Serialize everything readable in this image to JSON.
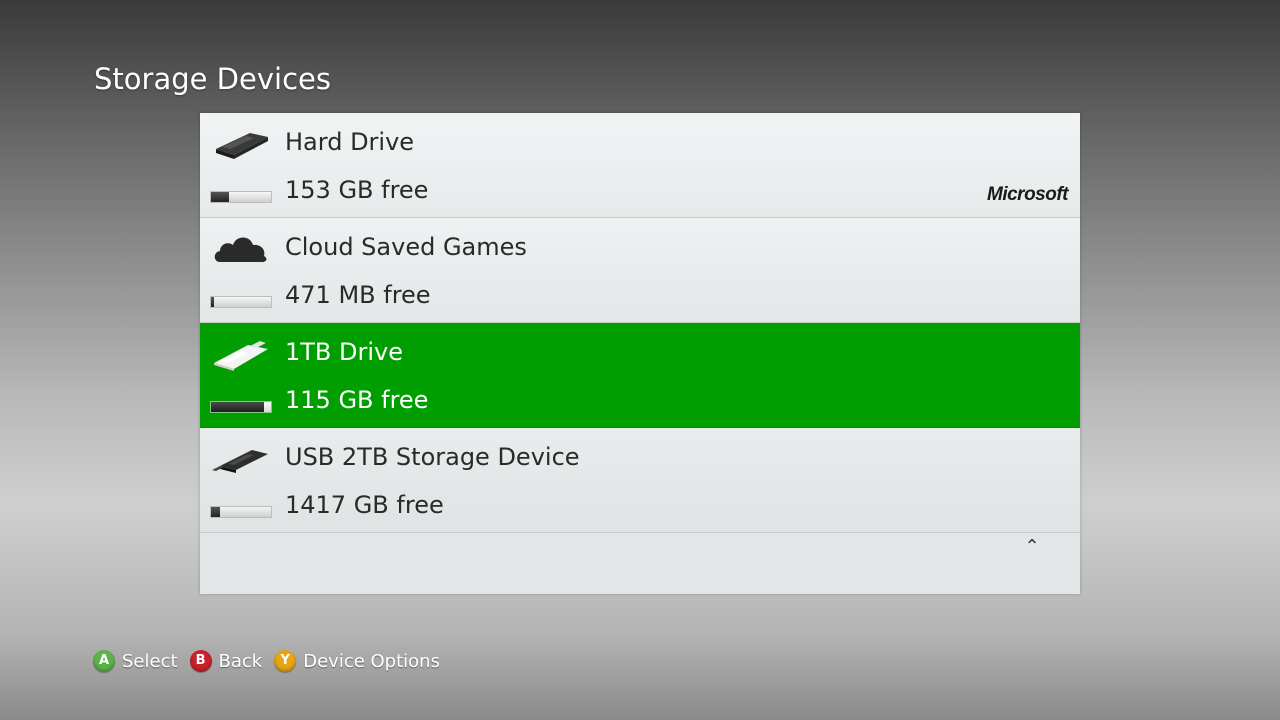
{
  "header": {
    "title": "Storage Devices"
  },
  "devices": [
    {
      "name": "Hard Drive",
      "free": "153 GB free",
      "used_fraction": 0.3,
      "brand": "Microsoft",
      "icon": "hard-drive-icon"
    },
    {
      "name": "Cloud Saved Games",
      "free": "471 MB free",
      "used_fraction": 0.05,
      "icon": "cloud-icon"
    },
    {
      "name": "1TB Drive",
      "free": "115 GB free",
      "used_fraction": 0.88,
      "icon": "usb-flash-drive-icon",
      "selected": true
    },
    {
      "name": "USB 2TB Storage Device",
      "free": "1417 GB free",
      "used_fraction": 0.15,
      "icon": "usb-stick-icon"
    }
  ],
  "scroll": {
    "icon": "chevron-up-icon",
    "glyph": "⌃"
  },
  "footer": {
    "hints": [
      {
        "key": "A",
        "label": "Select",
        "color": "#5db34a"
      },
      {
        "key": "B",
        "label": "Back",
        "color": "#c8232c"
      },
      {
        "key": "Y",
        "label": "Device Options",
        "color": "#e6a516"
      }
    ]
  },
  "colors": {
    "selected_row": "#009e00",
    "panel": "#e2e6e6"
  }
}
